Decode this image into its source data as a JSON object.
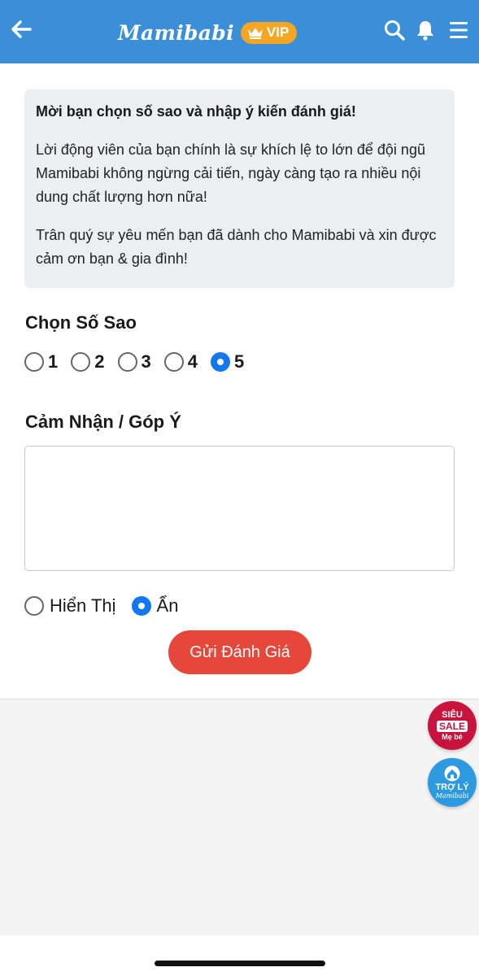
{
  "header": {
    "logo": "Mamibabi",
    "vip_label": "VIP",
    "accent_color": "#3a8fd8",
    "icons": [
      "back-arrow-icon",
      "search-icon",
      "bell-icon",
      "menu-icon"
    ]
  },
  "intro": {
    "heading": "Mời bạn chọn số sao và nhập ý kiến đánh giá!",
    "paragraph1": "Lời động viên của bạn chính là sự khích lệ to lớn để đội ngũ Mamibabi không ngừng cải tiến, ngày càng tạo ra nhiều nội dung chất lượng hơn nữa!",
    "paragraph2": "Trân quý sự yêu mến bạn đã dành cho Mamibabi và xin được cảm ơn bạn & gia đình!"
  },
  "rating": {
    "title": "Chọn Số Sao",
    "options": [
      "1",
      "2",
      "3",
      "4",
      "5"
    ],
    "selected": "5"
  },
  "feedback": {
    "title": "Cảm Nhận / Góp Ý",
    "value": "",
    "placeholder": ""
  },
  "visibility": {
    "options": [
      "Hiển Thị",
      "Ẩn"
    ],
    "selected": "Ẩn"
  },
  "submit_label": "Gửi Đánh Giá",
  "submit_color": "#e5473b",
  "floating": {
    "sale": {
      "line1": "SIÊU",
      "line2": "SALE",
      "line3": "Mẹ bé"
    },
    "assistant": {
      "line1": "TRỢ LÝ",
      "line2": "Mamibabi"
    }
  }
}
